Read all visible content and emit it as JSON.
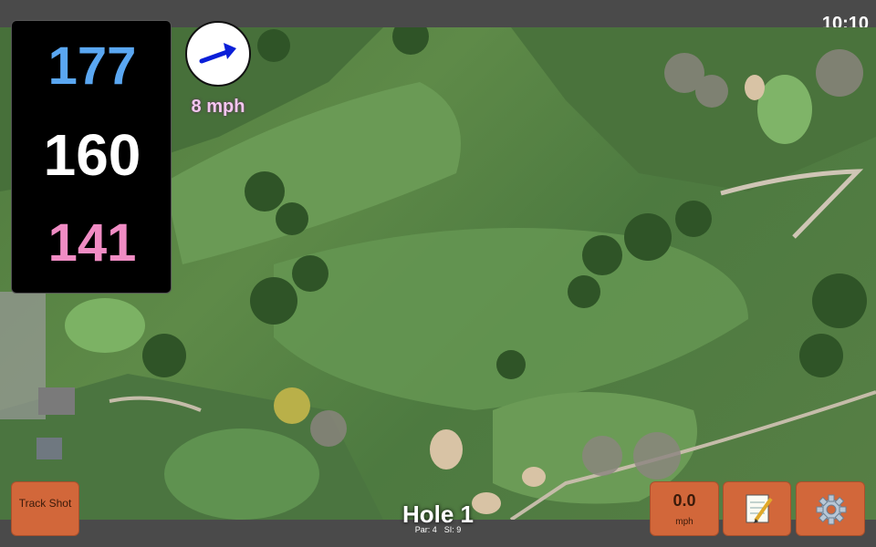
{
  "status": {
    "time": "10:10"
  },
  "distances": {
    "back": "177",
    "middle": "160",
    "front": "141"
  },
  "wind": {
    "speed": "8 mph",
    "direction_icon": "arrow-right-icon"
  },
  "buttons": {
    "track_shot": "Track Shot",
    "speed_value": "0.0",
    "speed_unit": "mph",
    "notes_icon": "notepad-icon",
    "settings_icon": "gear-icon"
  },
  "hole": {
    "title": "Hole 1",
    "par": "Par: 4",
    "si": "SI: 9"
  },
  "colors": {
    "back": "#5aa7f2",
    "middle": "#ffffff",
    "front": "#f08cc4",
    "button": "#d2673a"
  }
}
